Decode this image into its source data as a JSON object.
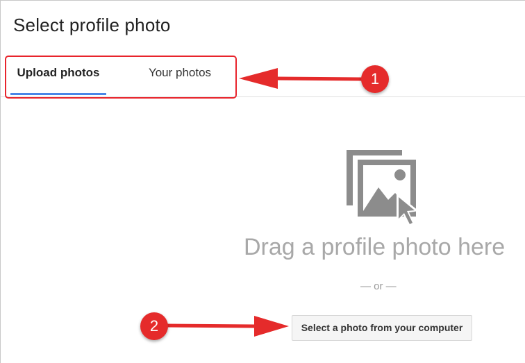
{
  "dialog": {
    "title": "Select profile photo",
    "tabs": [
      {
        "label": "Upload photos",
        "selected": true
      },
      {
        "label": "Your photos",
        "selected": false
      }
    ]
  },
  "upload": {
    "drag_text": "Drag a profile photo here",
    "or_text": "— or —",
    "select_button_label": "Select a photo from your computer",
    "icon": "photo-upload-icon"
  },
  "annotations": {
    "callout_1": "1",
    "callout_2": "2",
    "color": "#e52b2b"
  },
  "colors": {
    "tab_indicator": "#4a86e8",
    "icon_gray": "#8c8c8c"
  }
}
